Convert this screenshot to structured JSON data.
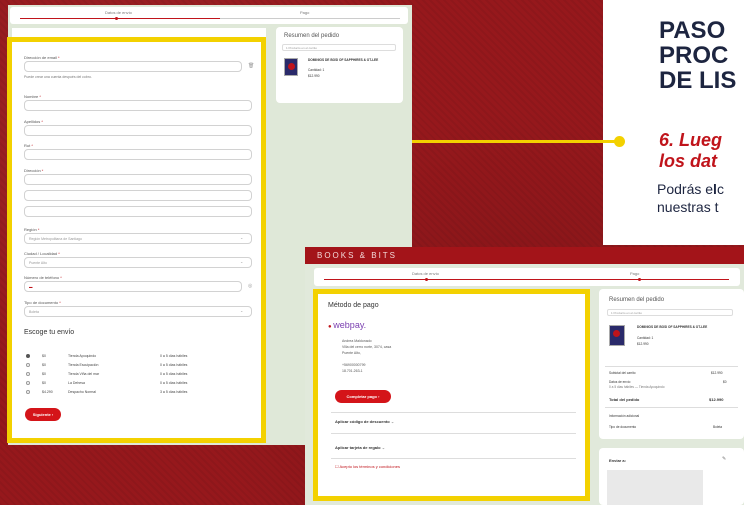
{
  "slide": {
    "heading_lines": [
      "PASO",
      "PROC",
      "DE LIS"
    ],
    "step_lines": [
      "6. Lueg",
      "los dat"
    ],
    "para_line1_plain": "Podrás e",
    "para_line1_bold": "l",
    "para_line1_rest": "c",
    "para_line2": "nuestras t"
  },
  "screen1": {
    "stepper": {
      "step1": "Datos de envío",
      "step2": "Pago"
    },
    "form": {
      "email_label": "Dirección de email",
      "email_hint": "Puede crear una cuenta después del cobro.",
      "name_label": "Nombre",
      "surname_label": "Apellidos",
      "rut_label": "Rut",
      "address_label": "Dirección",
      "region_label": "Región",
      "region_value": "Región Metropolitana de Santiago",
      "city_label": "Ciudad / Localidad",
      "city_value": "Puente Alto",
      "phone_label": "Número de teléfono",
      "doctype_label": "Tipo de documento",
      "doctype_value": "Boleta",
      "ship_title": "Escoge tu envío",
      "ship_options": [
        {
          "price": "$0",
          "name": "Tienda Apoquindo",
          "eta": "0 a 5 días hábiles",
          "selected": true
        },
        {
          "price": "$0",
          "name": "Tienda Escuipación",
          "eta": "0 a 5 días hábiles",
          "selected": false
        },
        {
          "price": "$0",
          "name": "Tienda Viña del mar",
          "eta": "0 a 5 días hábiles",
          "selected": false
        },
        {
          "price": "$0",
          "name": "La Dehesa",
          "eta": "0 a 5 días hábiles",
          "selected": false
        },
        {
          "price": "$4.290",
          "name": "Despacho Normal",
          "eta": "3 a 5 días hábiles",
          "selected": false
        }
      ],
      "next_button": "Siguiente"
    },
    "summary": {
      "title": "Resumen del pedido",
      "select": "1 Producto en el carrito",
      "book_title": "DOMINIOS DE BOSI OF SAPPHIRES & OT-LEE",
      "qty": "Cantidad: 1",
      "price": "$12.990"
    }
  },
  "screen2": {
    "brand": "BOOKS & BITS",
    "stepper": {
      "step1": "Datos de envío",
      "step2": "Pago"
    },
    "payment": {
      "title": "Método de pago",
      "logo": "webpay.",
      "address_lines": [
        "Andrea Maldonado",
        "Villa del cerro norte, 3074, casa",
        "Puente Alto,"
      ],
      "phone_lines": [
        "+56900000799",
        "18.701.263-1"
      ],
      "pay_button": "Completar pago",
      "discount": "Aplicar código de descuento",
      "gift": "Aplicar tarjeta de regalo",
      "terms": "Acepto los términos y condiciones"
    },
    "summary": {
      "title": "Resumen del pedido",
      "select": "1 Producto en el carrito",
      "book_title": "DOMINIOS DE BOSI OF SAPPHIRES & OT-LEE",
      "qty": "Cantidad: 1",
      "price": "$12.990",
      "subtotal_label": "Subtotal del carrito",
      "subtotal": "$12.990",
      "shipping_label": "Datos de envío",
      "shipping": "$0",
      "shipping_note": "0 a 5 días hábiles — Tienda Apoquindo",
      "total_label": "Total del pedido",
      "total": "$12.990",
      "extra": "Información adicional",
      "doc_label": "Tipo de documento",
      "doc_value": "Boleta"
    },
    "ship_to": "Enviar a:"
  },
  "colors": {
    "accent": "#c0141b",
    "yellow": "#f3d100",
    "navy": "#1d2540"
  }
}
